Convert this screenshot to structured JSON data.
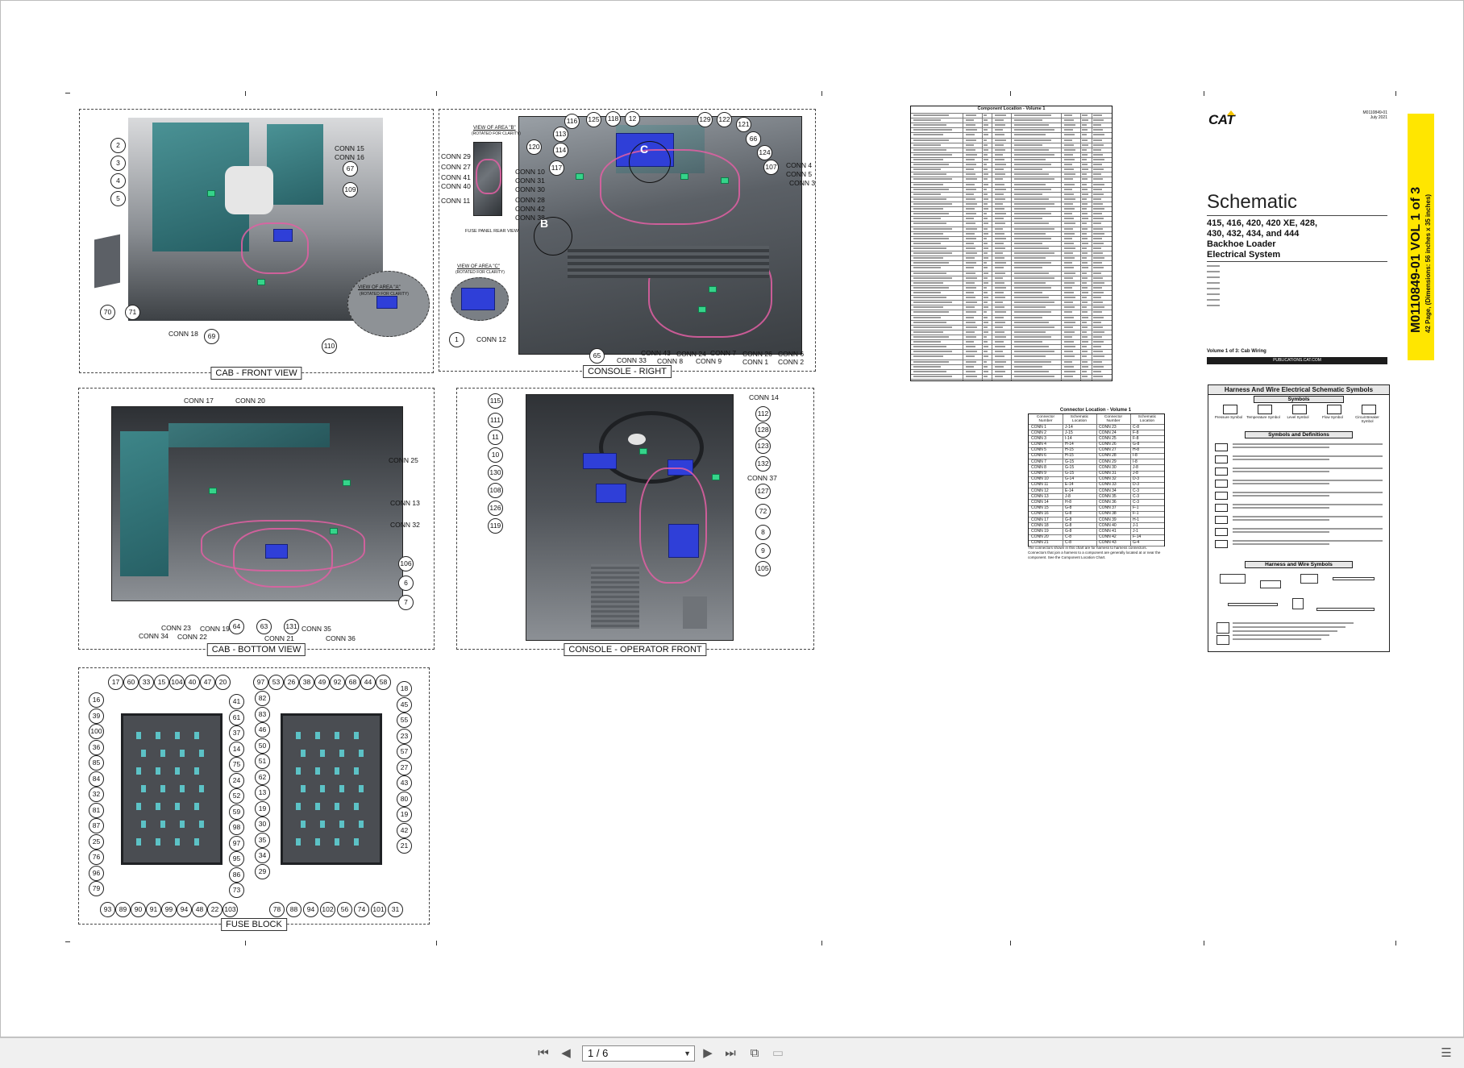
{
  "viewer": {
    "page_indicator": "1 / 6",
    "toolbar_icons": [
      "first-page-icon",
      "previous-page-icon",
      "next-page-icon",
      "last-page-icon",
      "fit-page-icon",
      "single-page-icon",
      "sidebar-icon"
    ]
  },
  "panels": {
    "cab_front": {
      "caption": "CAB - FRONT VIEW",
      "inset_title": "VIEW OF AREA \"A\"",
      "inset_sub": "(ROTATED FOR CLARITY)",
      "callouts": [
        "2",
        "3",
        "4",
        "5",
        "67",
        "109",
        "70",
        "71",
        "69",
        "110"
      ],
      "labels": [
        "CONN 15",
        "CONN 16",
        "CONN 18"
      ]
    },
    "console_right": {
      "caption": "CONSOLE - RIGHT",
      "view_b_title": "VIEW OF AREA \"B\"",
      "view_b_sub": "(ROTATED FOR CLARITY)",
      "fuse_rear_label": "FUSE PANEL REAR VIEW",
      "view_c_title": "VIEW OF AREA \"C\"",
      "view_c_sub": "(ROTATED FOR CLARITY)",
      "area_b": "B",
      "area_c": "C",
      "callouts": [
        "120",
        "116",
        "125",
        "118",
        "12",
        "129",
        "122",
        "121",
        "66",
        "113",
        "114",
        "117",
        "124",
        "107",
        "65",
        "1"
      ],
      "labels": [
        "CONN 29",
        "CONN 27",
        "CONN 41",
        "CONN 40",
        "CONN 11",
        "CONN 10",
        "CONN 31",
        "CONN 30",
        "CONN 28",
        "CONN 42",
        "CONN 38",
        "CONN 12",
        "CONN 4",
        "CONN 5",
        "CONN 3",
        "CONN 33",
        "CONN 43",
        "CONN 8",
        "CONN 24",
        "CONN 9",
        "CONN 7",
        "CONN 26",
        "CONN 1",
        "CONN 6",
        "CONN 2"
      ]
    },
    "cab_bottom": {
      "caption": "CAB - BOTTOM VIEW",
      "callouts": [
        "106",
        "6",
        "7",
        "64",
        "63",
        "131"
      ],
      "labels": [
        "CONN 17",
        "CONN 20",
        "CONN 25",
        "CONN 13",
        "CONN 32",
        "CONN 23",
        "CONN 34",
        "CONN 19",
        "CONN 22",
        "CONN 21",
        "CONN 35",
        "CONN 36"
      ]
    },
    "console_operator": {
      "caption": "CONSOLE - OPERATOR FRONT",
      "callouts": [
        "115",
        "111",
        "11",
        "10",
        "130",
        "108",
        "126",
        "119",
        "112",
        "128",
        "123",
        "132",
        "127",
        "72",
        "8",
        "9",
        "105"
      ],
      "labels": [
        "CONN 14",
        "CONN 37"
      ]
    },
    "fuse_block": {
      "caption": "FUSE BLOCK",
      "left_top": [
        "17",
        "60",
        "33",
        "15",
        "104",
        "40",
        "47",
        "20"
      ],
      "left_left": [
        "16",
        "39",
        "100",
        "36",
        "85",
        "84",
        "32",
        "81",
        "87",
        "25",
        "76",
        "96",
        "79"
      ],
      "left_right": [
        "41",
        "61",
        "37",
        "14",
        "75",
        "24",
        "52",
        "59",
        "98",
        "97",
        "95",
        "86",
        "73"
      ],
      "left_bottom": [
        "93",
        "89",
        "90",
        "91",
        "99",
        "94",
        "48",
        "22",
        "103"
      ],
      "right_top": [
        "97",
        "53",
        "26",
        "38",
        "49",
        "92",
        "68",
        "44",
        "58"
      ],
      "right_left": [
        "82",
        "83",
        "46",
        "50",
        "51",
        "62",
        "13",
        "19",
        "30",
        "35",
        "34",
        "29"
      ],
      "right_right": [
        "18",
        "45",
        "55",
        "23",
        "57",
        "27",
        "43",
        "80",
        "19",
        "42",
        "21"
      ],
      "right_bottom": [
        "78",
        "88",
        "94",
        "102",
        "56",
        "74",
        "101",
        "31"
      ]
    }
  },
  "component_table": {
    "title": "Component Location - Volume 1",
    "rows": 54
  },
  "connector_table": {
    "title": "Connector Location - Volume 1",
    "headers": [
      "Connector Number",
      "Schematic Location",
      "Connector Number",
      "Schematic Location"
    ],
    "rows": [
      [
        "CONN 1",
        "J-14",
        "CONN 23",
        "C-8"
      ],
      [
        "CONN 2",
        "J-15",
        "CONN 24",
        "F-8"
      ],
      [
        "CONN 3",
        "I-14",
        "CONN 25",
        "F-8"
      ],
      [
        "CONN 4",
        "H-14",
        "CONN 26",
        "G-8"
      ],
      [
        "CONN 5",
        "H-15",
        "CONN 27",
        "H-8"
      ],
      [
        "CONN 6",
        "H-15",
        "CONN 28",
        "I-8"
      ],
      [
        "CONN 7",
        "G-15",
        "CONN 29",
        "I-8"
      ],
      [
        "CONN 8",
        "G-15",
        "CONN 30",
        "J-8"
      ],
      [
        "CONN 9",
        "G-15",
        "CONN 31",
        "J-8"
      ],
      [
        "CONN 10",
        "G-14",
        "CONN 32",
        "D-3"
      ],
      [
        "CONN 11",
        "E-14",
        "CONN 33",
        "D-3"
      ],
      [
        "CONN 12",
        "E-14",
        "CONN 34",
        "C-3"
      ],
      [
        "CONN 13",
        "J-8",
        "CONN 35",
        "C-3"
      ],
      [
        "CONN 14",
        "H-8",
        "CONN 36",
        "C-3"
      ],
      [
        "CONN 15",
        "G-8",
        "CONN 37",
        "F-1"
      ],
      [
        "CONN 16",
        "G-8",
        "CONN 38",
        "F-1"
      ],
      [
        "CONN 17",
        "G-8",
        "CONN 39",
        "H-1"
      ],
      [
        "CONN 18",
        "G-8",
        "CONN 40",
        "J-1"
      ],
      [
        "CONN 19",
        "G-8",
        "CONN 41",
        "J-1"
      ],
      [
        "CONN 20",
        "C-8",
        "CONN 42",
        "F-14"
      ],
      [
        "CONN 21",
        "C-8",
        "CONN 43",
        "G-4"
      ]
    ],
    "note": "The connectors shown in this chart are for harness to harness connectors. Connectors that join a harness to a component are generally located at or near the component. See the Component Location Chart."
  },
  "title_block": {
    "logo": "CAT",
    "doc_number": "M0110849-01",
    "date": "July 2021",
    "title": "Schematic",
    "models_line1": "415, 416, 420, 420 XE, 428,",
    "models_line2": "430, 432, 434, and 444",
    "subtitle1": "Backhoe Loader",
    "subtitle2": "Electrical System",
    "volume": "Volume 1 of 3: Cab Wiring",
    "publication_bar": "PUBLICATIONS.CAT.COM",
    "vertical_title": "M0110849-01 VOL 1 of 3",
    "vertical_sub": "42 Page, (Dimensions: 56 inches x 35 inches)"
  },
  "symbols_panel": {
    "title": "Harness And Wire Electrical Schematic Symbols",
    "symbols_header": "Symbols",
    "symbol_names": [
      "Pressure Symbol",
      "Temperature Symbol",
      "Level Symbol",
      "Flow Symbol",
      "Circuit Breaker Symbol"
    ],
    "definitions_header": "Symbols and Definitions",
    "harness_header": "Harness and Wire Symbols"
  },
  "colors": {
    "accent_yellow": "#ffe600",
    "harness_pink": "#e25fa3",
    "connector_green": "#35d48a",
    "module_blue": "#2f3fd8",
    "glass_teal": "#2f7a7e"
  }
}
